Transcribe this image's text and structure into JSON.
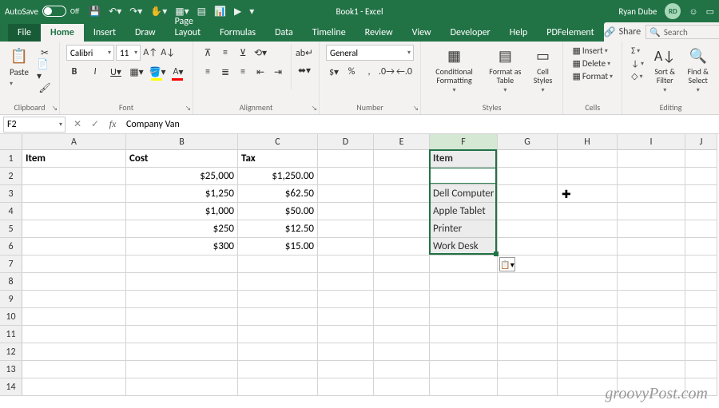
{
  "title": "Book1 - Excel",
  "user": {
    "name": "Ryan Dube",
    "initials": "RD"
  },
  "autosave": {
    "label": "AutoSave",
    "state": "Off"
  },
  "tabs": [
    "File",
    "Home",
    "Insert",
    "Draw",
    "Page Layout",
    "Formulas",
    "Data",
    "Timeline",
    "Review",
    "View",
    "Developer",
    "Help",
    "PDFelement"
  ],
  "activeTab": "Home",
  "share": "Share",
  "searchPlaceholder": "Search",
  "ribbon": {
    "clipboard": {
      "label": "Clipboard",
      "paste": "Paste"
    },
    "font": {
      "label": "Font",
      "family": "Calibri",
      "size": "11"
    },
    "alignment": {
      "label": "Alignment"
    },
    "number": {
      "label": "Number",
      "format": "General"
    },
    "styles": {
      "label": "Styles",
      "cond": "Conditional Formatting",
      "table": "Format as Table",
      "cell": "Cell Styles"
    },
    "cells": {
      "label": "Cells",
      "insert": "Insert",
      "delete": "Delete",
      "format": "Format"
    },
    "editing": {
      "label": "Editing",
      "sort": "Sort & Filter",
      "find": "Find & Select"
    }
  },
  "namebox": "F2",
  "formula": "Company Van",
  "columns": [
    "A",
    "B",
    "C",
    "D",
    "E",
    "F",
    "G",
    "H",
    "I",
    "J"
  ],
  "rows_visible": 14,
  "headers": {
    "A1": "Item",
    "B1": "Cost",
    "C1": "Tax",
    "F1": "Item"
  },
  "data": {
    "B2": "$25,000",
    "C2": "$1,250.00",
    "F2": "Company Van",
    "B3": "$1,250",
    "C3": "$62.50",
    "F3": "Dell Computer",
    "B4": "$1,000",
    "C4": "$50.00",
    "F4": "Apple Tablet",
    "B5": "$250",
    "C5": "$12.50",
    "F5": "Printer",
    "B6": "$300",
    "C6": "$15.00",
    "F6": "Work Desk"
  },
  "watermark": "groovyPost.com"
}
